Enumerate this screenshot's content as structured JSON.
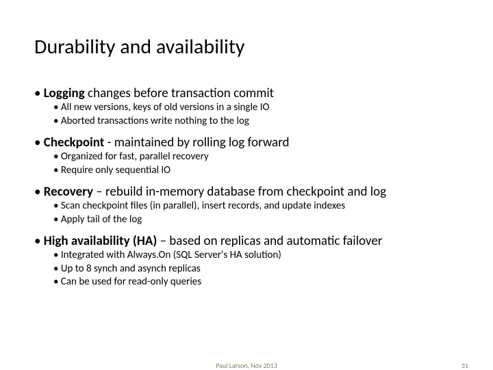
{
  "title": "Durability and availability",
  "sections": [
    {
      "bold": "Logging",
      "rest": " changes before transaction commit",
      "subs": [
        "All new versions, keys of old versions in a single IO",
        "Aborted transactions write nothing to the log"
      ]
    },
    {
      "bold": "Checkpoint",
      "rest": "  - maintained by rolling log forward",
      "subs": [
        "Organized for fast, parallel recovery",
        "Require only sequential IO"
      ]
    },
    {
      "bold": "Recovery",
      "rest": " – rebuild in-memory database from checkpoint and log",
      "subs": [
        "Scan checkpoint files (in parallel), insert records, and update indexes",
        "Apply tail of the log"
      ]
    },
    {
      "bold": "High availability (HA)",
      "rest": " – based on replicas and automatic failover",
      "subs": [
        "Integrated with Always.On (SQL Server's HA solution)",
        "Up to 8 synch and asynch replicas",
        "Can be used for read-only queries"
      ]
    }
  ],
  "footer": {
    "center": "Paul Larson, Nov 2013",
    "page": "31"
  }
}
